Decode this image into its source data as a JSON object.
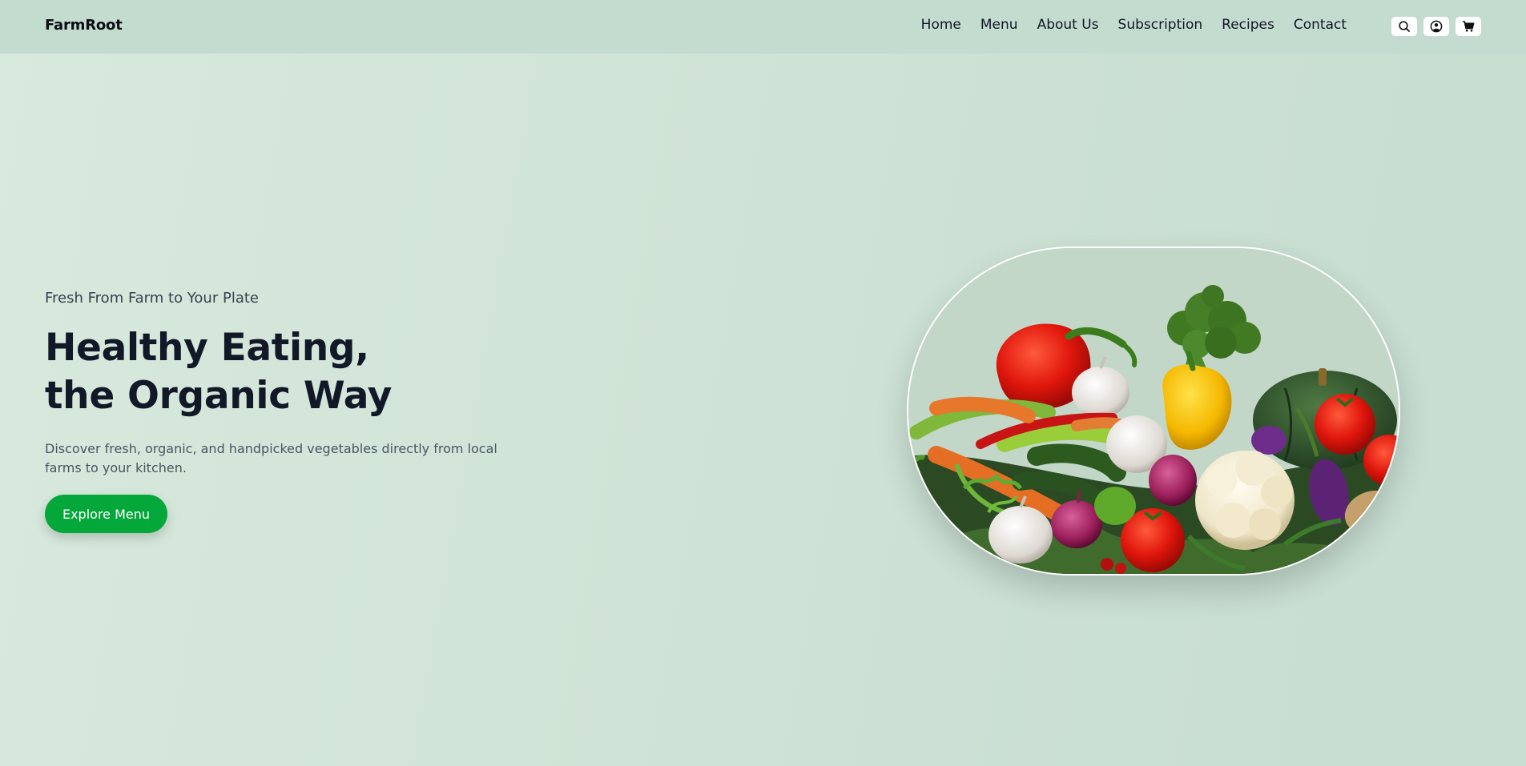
{
  "header": {
    "brand": "FarmRoot",
    "nav": [
      "Home",
      "Menu",
      "About Us",
      "Subscription",
      "Recipes",
      "Contact"
    ],
    "icons": [
      "search-icon",
      "user-icon",
      "cart-icon"
    ]
  },
  "hero": {
    "subtitle": "Fresh From Farm to Your Plate",
    "headline_line1": "Healthy Eating,",
    "headline_line2": "the Organic Way",
    "description": "Discover fresh, organic, and handpicked vegetables directly from local farms to your kitchen.",
    "cta_label": "Explore Menu"
  },
  "colors": {
    "accent": "#04a73a",
    "header_bg": "#c4dcd0",
    "text_dark": "#111827"
  }
}
